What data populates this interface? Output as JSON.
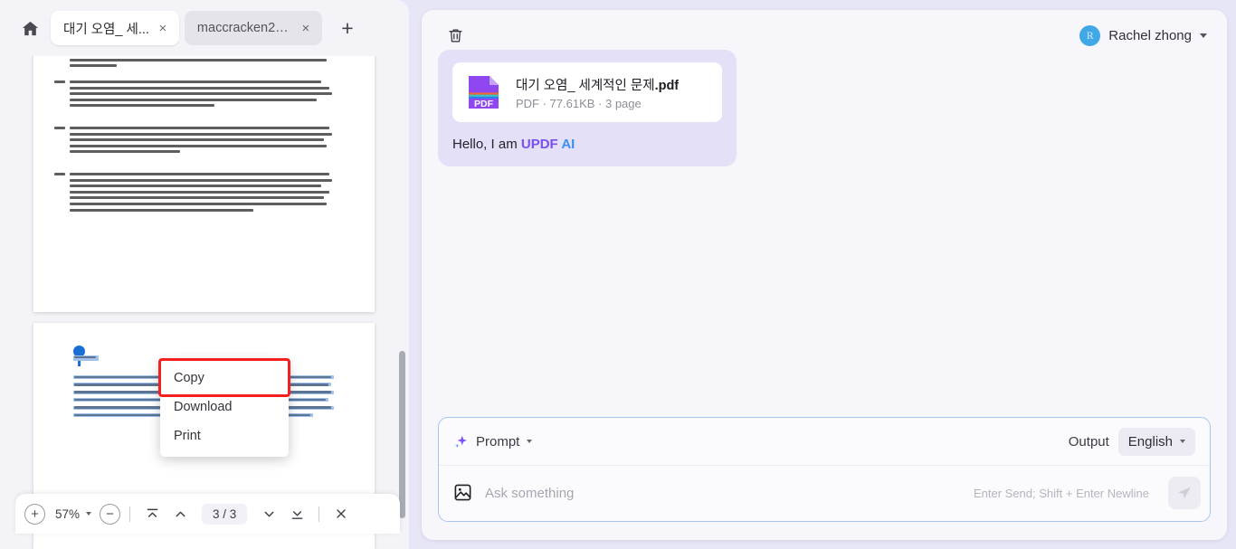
{
  "viewer": {
    "home_icon": "home-icon",
    "new_tab_icon": "plus-icon",
    "tabs": [
      {
        "label": "대기 오염_ 세...",
        "close": "×",
        "active": true
      },
      {
        "label": "maccracken2_...",
        "close": "×",
        "active": false
      }
    ],
    "toolbar": {
      "zoom_in": "+",
      "zoom_out": "−",
      "zoom_value": "57%",
      "page_indicator": "3 / 3",
      "first_page_icon": "page-top-icon",
      "prev_page_icon": "chevron-up-icon",
      "next_page_icon": "chevron-down-icon",
      "last_page_icon": "page-bottom-icon",
      "close_icon": "×"
    },
    "context_menu": {
      "items": [
        {
          "label": "Copy",
          "highlighted": true
        },
        {
          "label": "Download",
          "highlighted": false
        },
        {
          "label": "Print",
          "highlighted": false
        }
      ],
      "highlight_color": "#f61f1f"
    },
    "selection_color": "#9fc1ea"
  },
  "chat": {
    "delete_icon": "trash-icon",
    "user": {
      "avatar_initial": "R",
      "name": "Rachel zhong",
      "avatar_color": "#41a8e8",
      "chevron": "chevron-down-icon"
    },
    "message": {
      "file": {
        "icon": "pdf-file-icon",
        "name_base": "대기 오염_ 세계적인 문제",
        "name_ext": ".pdf",
        "meta": "PDF · 77.61KB · 3 page"
      },
      "greeting_prefix": "Hello, I am ",
      "brand_updf": "UPDF",
      "brand_ai": " AI"
    },
    "composer": {
      "prompt_icon": "sparkle-icon",
      "prompt_label": "Prompt",
      "prompt_caret": "chevron-down-icon",
      "output_label": "Output",
      "language_value": "English",
      "language_caret": "chevron-down-icon",
      "image_icon": "image-icon",
      "input_value": "",
      "input_placeholder": "Ask something",
      "hint": "Enter Send; Shift + Enter Newline",
      "send_icon": "send-icon"
    }
  }
}
